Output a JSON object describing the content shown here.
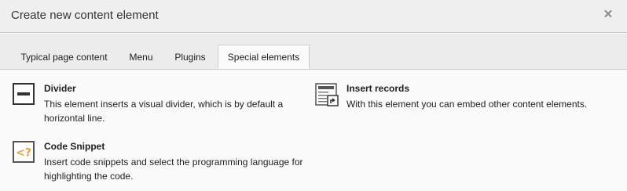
{
  "dialog": {
    "title": "Create new content element",
    "close_glyph": "✕",
    "close_icon": "close-icon"
  },
  "tabs": [
    {
      "label": "Typical page content",
      "active": false
    },
    {
      "label": "Menu",
      "active": false
    },
    {
      "label": "Plugins",
      "active": false
    },
    {
      "label": "Special elements",
      "active": true
    }
  ],
  "elements": [
    {
      "title": "Divider",
      "description": "This element inserts a visual divider, which is by default a horizontal line.",
      "icon": "divider-icon"
    },
    {
      "title": "Insert records",
      "description": "With this element you can embed other content elements.",
      "icon": "insert-records-icon"
    },
    {
      "title": "Code Snippet",
      "description": "Insert code snippets and select the programming language for highlighting the code.",
      "icon": "code-snippet-icon",
      "icon_text": "<?"
    }
  ],
  "colors": {
    "icon_accent": "#e8a33d",
    "icon_dark": "#333333"
  }
}
